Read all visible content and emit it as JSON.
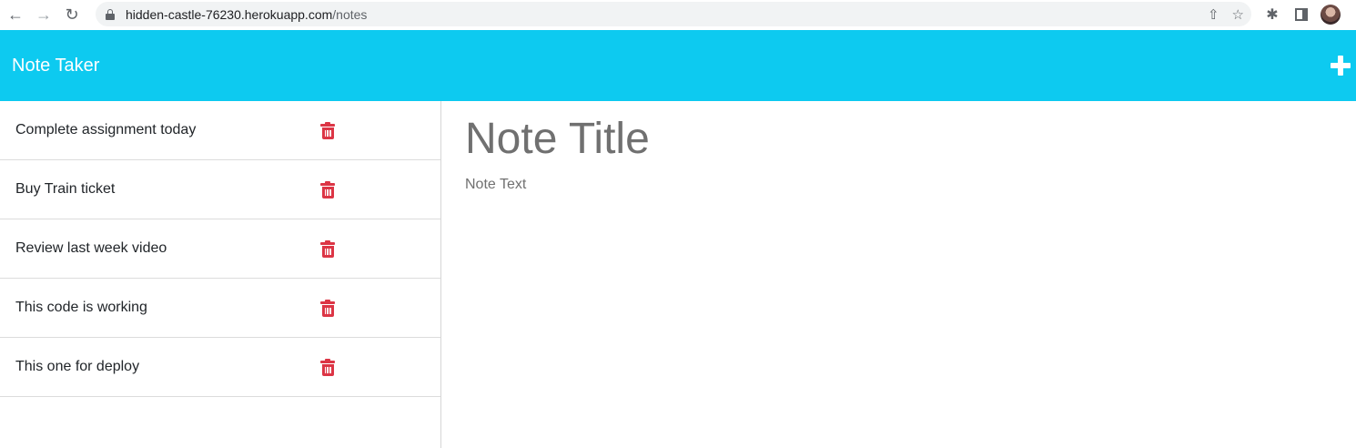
{
  "browser": {
    "url_host": "hidden-castle-76230.herokuapp.com",
    "url_path": "/notes"
  },
  "app": {
    "title": "Note Taker",
    "header_color": "#0dcaf0"
  },
  "notes": [
    {
      "title": "Complete assignment today"
    },
    {
      "title": "Buy Train ticket"
    },
    {
      "title": "Review last week video"
    },
    {
      "title": "This code is working"
    },
    {
      "title": "This one for deploy"
    }
  ],
  "editor": {
    "title_placeholder": "Note Title",
    "text_placeholder": "Note Text"
  },
  "colors": {
    "delete_icon": "#dc3545"
  }
}
